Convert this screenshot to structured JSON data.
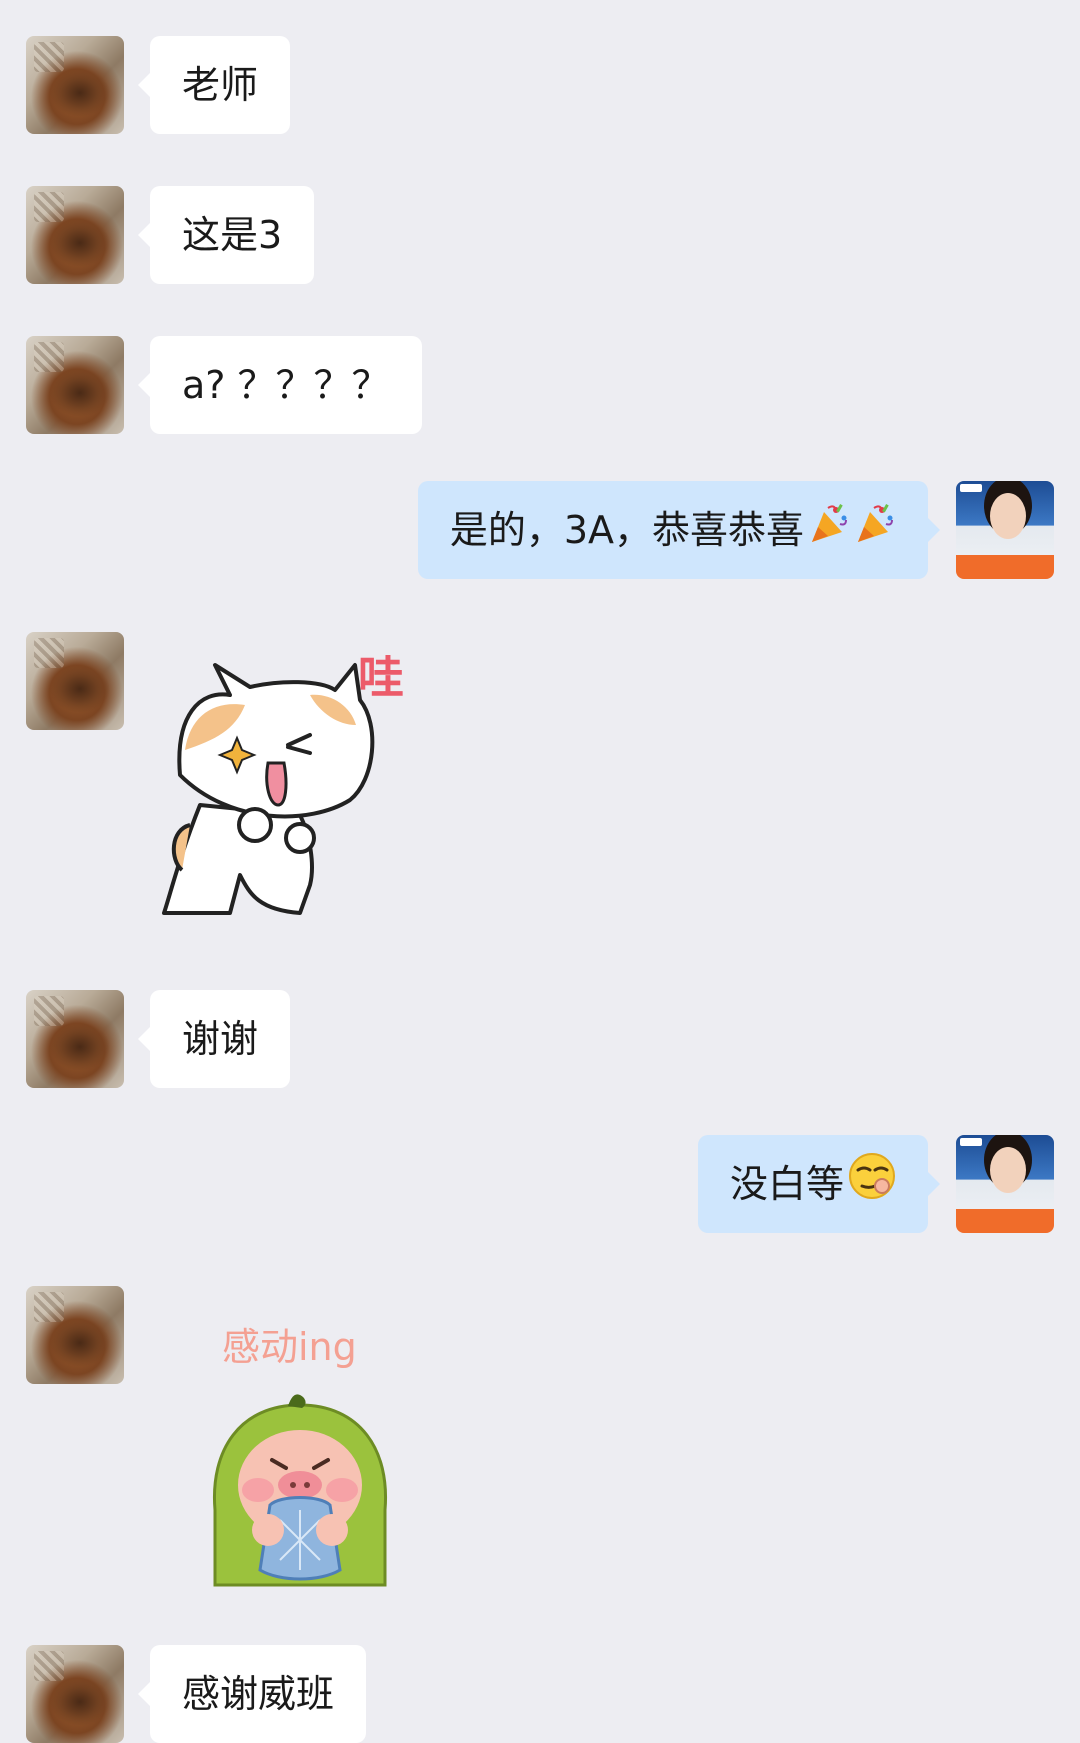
{
  "messages": [
    {
      "side": "left",
      "type": "text",
      "text": "老师"
    },
    {
      "side": "left",
      "type": "text",
      "text": "这是3"
    },
    {
      "side": "left",
      "type": "text",
      "text": "a? ？？？？"
    },
    {
      "side": "right",
      "type": "text",
      "text": "是的，3A，恭喜恭喜",
      "emoji": [
        "party-popper-icon",
        "party-popper-icon"
      ]
    },
    {
      "side": "left",
      "type": "sticker",
      "sticker": "cat-wow-sticker",
      "caption": "哇"
    },
    {
      "side": "left",
      "type": "text",
      "text": "谢谢"
    },
    {
      "side": "right",
      "type": "text",
      "text": "没白等",
      "emoji": [
        "smirk-face-icon"
      ]
    },
    {
      "side": "left",
      "type": "sticker",
      "sticker": "pig-crying-sticker",
      "caption": "感动ing"
    },
    {
      "side": "left",
      "type": "text",
      "text": "感谢威班"
    }
  ],
  "colors": {
    "background": "#ededf2",
    "bubble_left": "#ffffff",
    "bubble_right": "#cfe6fd",
    "text": "#1a1a1a"
  }
}
